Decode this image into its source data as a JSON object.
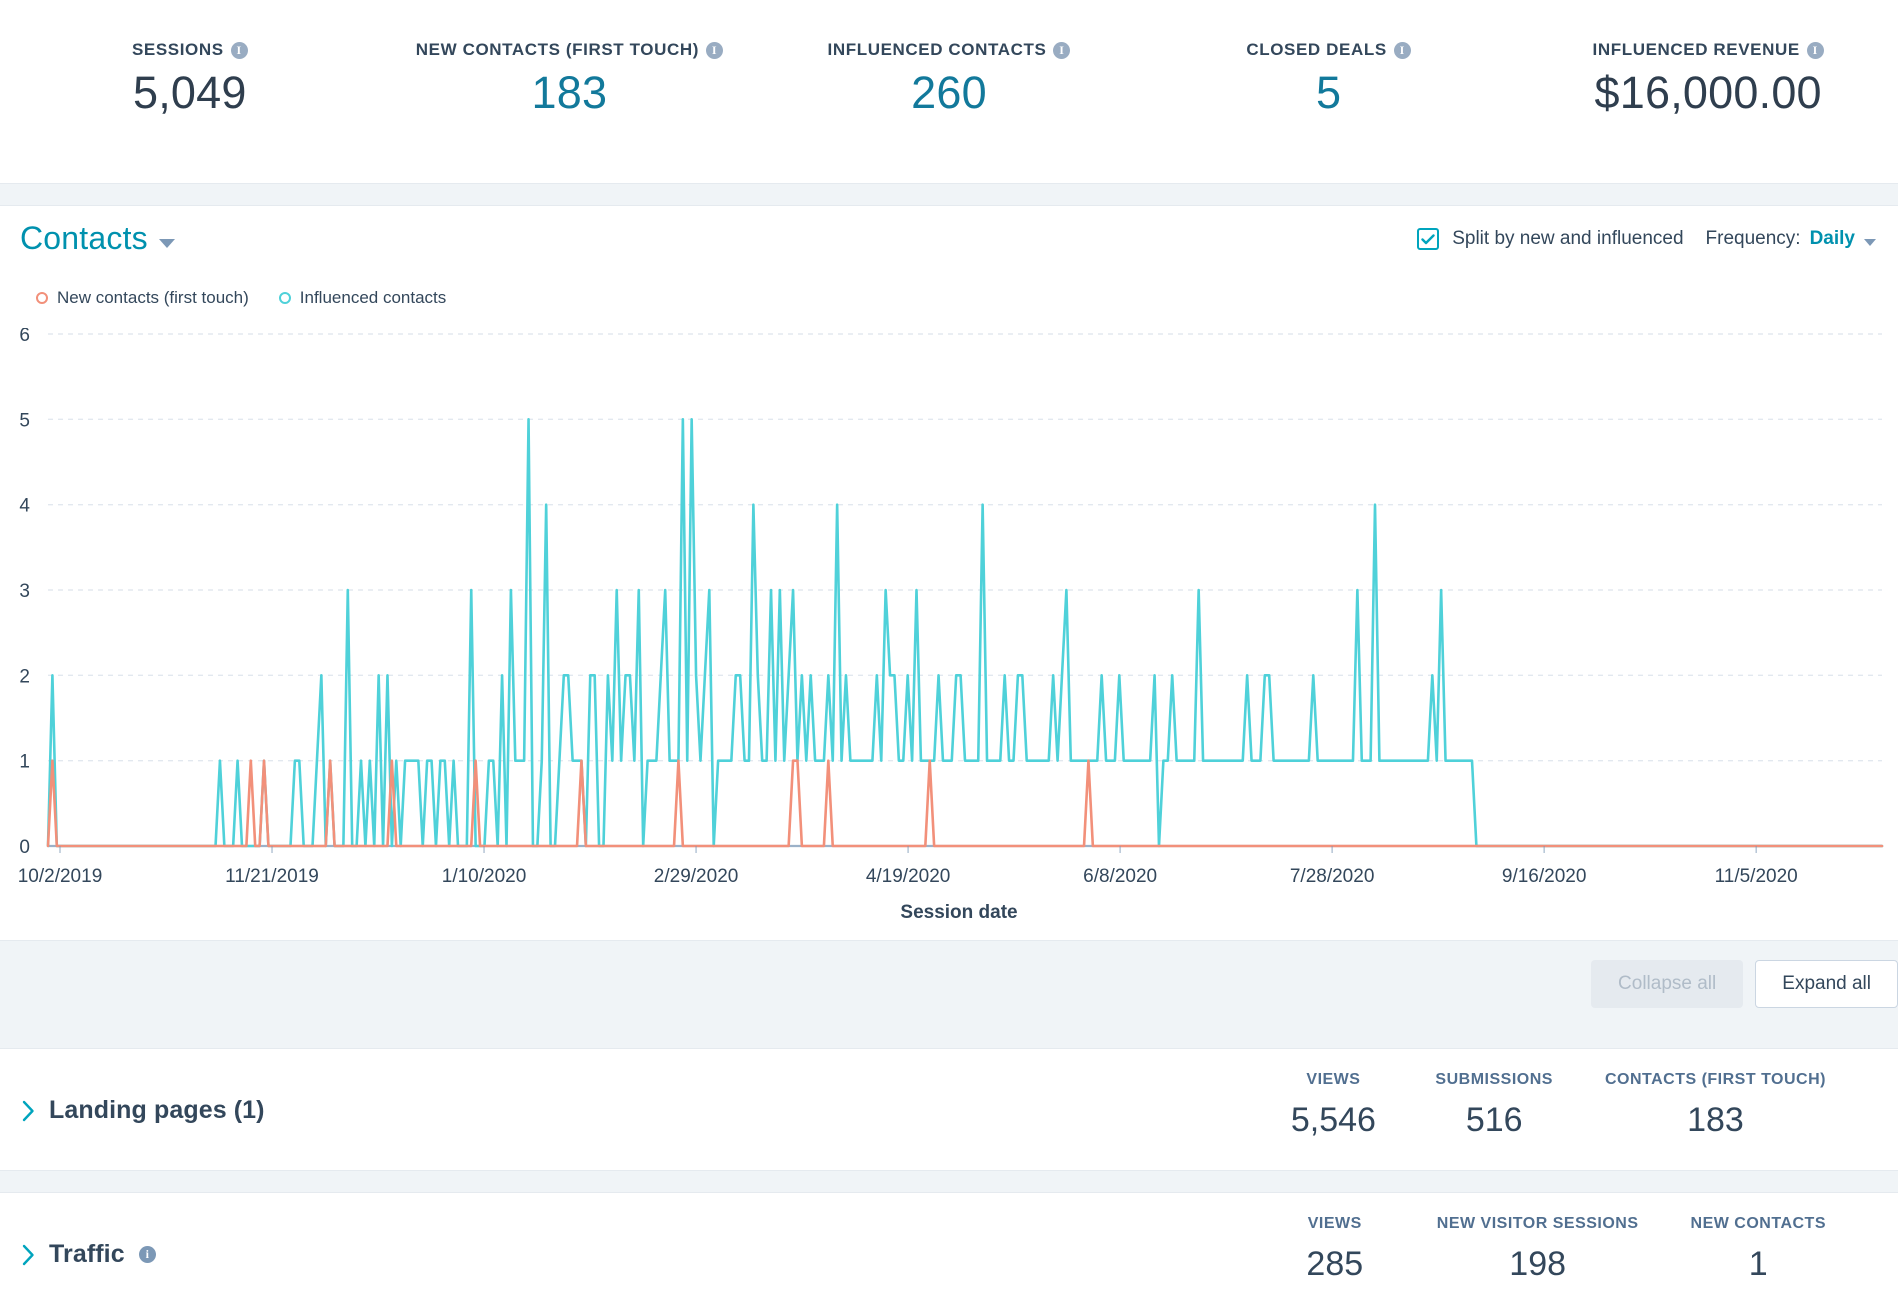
{
  "kpis": [
    {
      "label": "SESSIONS",
      "value": "5,049",
      "accent": false,
      "has_info": true,
      "info_icon": "info-icon"
    },
    {
      "label": "NEW CONTACTS (FIRST TOUCH)",
      "value": "183",
      "accent": true,
      "has_info": true,
      "info_icon": "info-icon"
    },
    {
      "label": "INFLUENCED CONTACTS",
      "value": "260",
      "accent": true,
      "has_info": true,
      "info_icon": "info-icon"
    },
    {
      "label": "CLOSED DEALS",
      "value": "5",
      "accent": true,
      "has_info": true,
      "info_icon": "info-icon"
    },
    {
      "label": "INFLUENCED REVENUE",
      "value": "$16,000.00",
      "accent": false,
      "has_info": true,
      "info_icon": "info-icon"
    }
  ],
  "chart_panel": {
    "metric_selector": {
      "label": "Contacts",
      "icon": "chevron-down-icon"
    },
    "split_checkbox": {
      "label": "Split by new and influenced",
      "checked": true,
      "icon": "checkbox-checked-icon"
    },
    "frequency": {
      "label": "Frequency:",
      "value": "Daily",
      "icon": "chevron-down-icon"
    }
  },
  "chart_data": {
    "type": "line",
    "title": "Contacts",
    "xlabel": "Session date",
    "ylabel": "",
    "ylim": [
      0,
      6
    ],
    "yticks": [
      0,
      1,
      2,
      3,
      4,
      5,
      6
    ],
    "xtick_labels": [
      "10/2/2019",
      "11/21/2019",
      "1/10/2020",
      "2/29/2020",
      "4/19/2020",
      "6/8/2020",
      "7/28/2020",
      "9/16/2020",
      "11/5/2020"
    ],
    "grid": true,
    "legend_position": "top-left",
    "colors": {
      "new_contacts": "#f2907a",
      "influenced_contacts": "#4fd1d9",
      "grid": "#cbd6e2",
      "axis": "#7c98b6"
    },
    "series": [
      {
        "name": "New contacts (first touch)",
        "color": "#f2907a",
        "values": [
          0,
          1,
          0,
          0,
          0,
          0,
          0,
          0,
          0,
          0,
          0,
          0,
          0,
          0,
          0,
          0,
          0,
          0,
          0,
          0,
          0,
          0,
          0,
          0,
          0,
          0,
          0,
          0,
          0,
          0,
          0,
          0,
          0,
          0,
          0,
          0,
          0,
          0,
          0,
          0,
          0,
          0,
          0,
          0,
          0,
          0,
          1,
          0,
          0,
          1,
          0,
          0,
          0,
          0,
          0,
          0,
          0,
          0,
          0,
          0,
          0,
          0,
          0,
          0,
          1,
          0,
          0,
          0,
          0,
          0,
          0,
          0,
          0,
          0,
          0,
          0,
          0,
          0,
          1,
          0,
          0,
          0,
          0,
          0,
          0,
          0,
          0,
          0,
          0,
          0,
          0,
          0,
          0,
          0,
          0,
          0,
          0,
          1,
          0,
          0,
          0,
          0,
          0,
          0,
          0,
          0,
          0,
          0,
          0,
          0,
          0,
          0,
          0,
          0,
          0,
          0,
          0,
          0,
          0,
          0,
          0,
          1,
          0,
          0,
          0,
          0,
          0,
          0,
          0,
          0,
          0,
          0,
          0,
          0,
          0,
          0,
          0,
          0,
          0,
          0,
          0,
          0,
          0,
          1,
          0,
          0,
          0,
          0,
          0,
          0,
          0,
          0,
          0,
          0,
          0,
          0,
          0,
          0,
          0,
          0,
          0,
          0,
          0,
          0,
          0,
          0,
          0,
          0,
          0,
          1,
          1,
          0,
          0,
          0,
          0,
          0,
          0,
          1,
          0,
          0,
          0,
          0,
          0,
          0,
          0,
          0,
          0,
          0,
          0,
          0,
          0,
          0,
          0,
          0,
          0,
          0,
          0,
          0,
          0,
          0,
          1,
          0,
          0,
          0,
          0,
          0,
          0,
          0,
          0,
          0,
          0,
          0,
          0,
          0,
          0,
          0,
          0,
          0,
          0,
          0,
          0,
          0,
          0,
          0,
          0,
          0,
          0,
          0,
          0,
          0,
          0,
          0,
          0,
          0,
          0,
          0,
          1,
          0,
          0,
          0,
          0,
          0,
          0,
          0,
          0,
          0,
          0,
          0,
          0,
          0,
          0,
          0,
          0,
          0,
          0,
          0,
          0,
          0,
          0,
          0,
          0,
          0,
          0,
          0,
          0,
          0,
          0,
          0,
          0,
          0,
          0,
          0,
          0,
          0,
          0,
          0,
          0,
          0,
          0,
          0,
          0,
          0,
          0,
          0,
          0,
          0,
          0,
          0,
          0,
          0,
          0,
          0,
          0,
          0,
          0,
          0,
          0,
          0,
          0,
          0,
          0,
          0,
          0,
          0,
          0,
          0,
          0,
          0,
          0,
          0,
          0,
          0,
          0,
          0,
          0,
          0,
          0,
          0,
          0,
          0,
          0,
          0,
          0,
          0,
          0,
          0,
          0,
          0,
          0,
          0,
          0,
          0,
          0,
          0,
          0,
          0,
          0,
          0,
          0,
          0,
          0,
          0,
          0,
          0,
          0,
          0,
          0,
          0,
          0,
          0,
          0,
          0,
          0,
          0,
          0,
          0,
          0,
          0,
          0,
          0,
          0,
          0,
          0,
          0,
          0,
          0,
          0,
          0,
          0,
          0,
          0,
          0,
          0,
          0,
          0,
          0,
          0,
          0,
          0,
          0,
          0,
          0,
          0,
          0,
          0,
          0,
          0,
          0,
          0,
          0,
          0,
          0,
          0,
          0,
          0,
          0
        ]
      },
      {
        "name": "Influenced contacts",
        "color": "#4fd1d9",
        "values": [
          0,
          2,
          0,
          0,
          0,
          0,
          0,
          0,
          0,
          0,
          0,
          0,
          0,
          0,
          0,
          0,
          0,
          0,
          0,
          0,
          0,
          0,
          0,
          0,
          0,
          0,
          0,
          0,
          0,
          0,
          0,
          0,
          0,
          0,
          0,
          0,
          0,
          0,
          0,
          1,
          0,
          0,
          0,
          1,
          0,
          0,
          0,
          0,
          0,
          1,
          0,
          0,
          0,
          0,
          0,
          0,
          1,
          1,
          0,
          0,
          0,
          1,
          2,
          0,
          1,
          0,
          0,
          0,
          3,
          0,
          0,
          1,
          0,
          1,
          0,
          2,
          0,
          2,
          0,
          1,
          0,
          1,
          1,
          1,
          1,
          0,
          1,
          1,
          0,
          1,
          1,
          0,
          1,
          0,
          0,
          0,
          3,
          0,
          0,
          0,
          1,
          1,
          0,
          2,
          0,
          3,
          1,
          1,
          1,
          5,
          0,
          0,
          1,
          4,
          0,
          0,
          1,
          2,
          2,
          1,
          1,
          1,
          0,
          2,
          2,
          0,
          0,
          2,
          1,
          3,
          1,
          2,
          2,
          1,
          3,
          0,
          1,
          1,
          1,
          2,
          3,
          1,
          1,
          1,
          5,
          1,
          5,
          2,
          1,
          2,
          3,
          0,
          1,
          1,
          1,
          1,
          2,
          2,
          1,
          1,
          4,
          2,
          1,
          1,
          3,
          1,
          3,
          1,
          2,
          3,
          1,
          2,
          1,
          2,
          1,
          1,
          1,
          2,
          1,
          4,
          1,
          2,
          1,
          1,
          1,
          1,
          1,
          1,
          2,
          1,
          3,
          2,
          2,
          1,
          1,
          2,
          1,
          3,
          1,
          1,
          1,
          1,
          2,
          1,
          1,
          1,
          2,
          2,
          1,
          1,
          1,
          1,
          4,
          1,
          1,
          1,
          1,
          2,
          1,
          1,
          2,
          2,
          1,
          1,
          1,
          1,
          1,
          1,
          2,
          1,
          2,
          3,
          1,
          1,
          1,
          1,
          1,
          1,
          1,
          2,
          1,
          1,
          1,
          2,
          1,
          1,
          1,
          1,
          1,
          1,
          1,
          2,
          0,
          1,
          1,
          2,
          1,
          1,
          1,
          1,
          1,
          3,
          1,
          1,
          1,
          1,
          1,
          1,
          1,
          1,
          1,
          1,
          2,
          1,
          1,
          1,
          2,
          2,
          1,
          1,
          1,
          1,
          1,
          1,
          1,
          1,
          1,
          2,
          1,
          1,
          1,
          1,
          1,
          1,
          1,
          1,
          1,
          3,
          1,
          1,
          1,
          4,
          1,
          1,
          1,
          1,
          1,
          1,
          1,
          1,
          1,
          1,
          1,
          1,
          2,
          1,
          3,
          1,
          1,
          1,
          1,
          1,
          1,
          1,
          0,
          0,
          0,
          0,
          0,
          0,
          0,
          0,
          0,
          0,
          0,
          0,
          0,
          0,
          0,
          0,
          0,
          0,
          0,
          0,
          0,
          0,
          0,
          0,
          0,
          0,
          0,
          0,
          0,
          0,
          0,
          0,
          0,
          0,
          0,
          0,
          0,
          0,
          0,
          0,
          0,
          0,
          0,
          0,
          0,
          0,
          0,
          0,
          0,
          0,
          0,
          0,
          0,
          0,
          0,
          0,
          0,
          0,
          0,
          0,
          0,
          0,
          0,
          0,
          0,
          0,
          0,
          0,
          0,
          0,
          0,
          0,
          0,
          0,
          0,
          0,
          0,
          0,
          0,
          0,
          0,
          0,
          0,
          0,
          0,
          0,
          0,
          0,
          0,
          0,
          0,
          0,
          0
        ]
      }
    ]
  },
  "toolbar": {
    "collapse_all": "Collapse all",
    "expand_all": "Expand all"
  },
  "sections": [
    {
      "title": "Landing pages (1)",
      "has_info": false,
      "chevron_icon": "chevron-right-icon",
      "metrics": [
        {
          "header": "VIEWS",
          "value": "5,546"
        },
        {
          "header": "SUBMISSIONS",
          "value": "516"
        },
        {
          "header": "CONTACTS (FIRST TOUCH)",
          "value": "183"
        }
      ]
    },
    {
      "title": "Traffic",
      "has_info": true,
      "info_icon": "info-icon",
      "chevron_icon": "chevron-right-icon",
      "metrics": [
        {
          "header": "VIEWS",
          "value": "285"
        },
        {
          "header": "NEW VISITOR SESSIONS",
          "value": "198"
        },
        {
          "header": "NEW CONTACTS",
          "value": "1"
        }
      ]
    }
  ]
}
